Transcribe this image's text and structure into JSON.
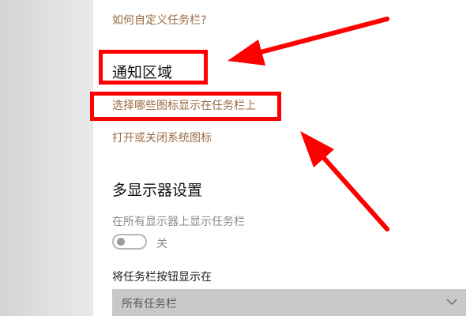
{
  "links": {
    "customize_taskbar": "如何自定义任务栏?",
    "select_icons": "选择哪些图标显示在任务栏上",
    "system_icons": "打开或关闭系统图标"
  },
  "notification_area": {
    "title": "通知区域"
  },
  "multi_display": {
    "title": "多显示器设置",
    "show_on_all_label": "在所有显示器上显示任务栏",
    "toggle_state": "关",
    "toggle_on": false,
    "buttons_label": "将任务栏按钮显示在",
    "dropdown_value": "所有任务栏"
  },
  "annotation_color": "#ff0000",
  "icons": {
    "dropdown": "chevron-down-icon"
  }
}
